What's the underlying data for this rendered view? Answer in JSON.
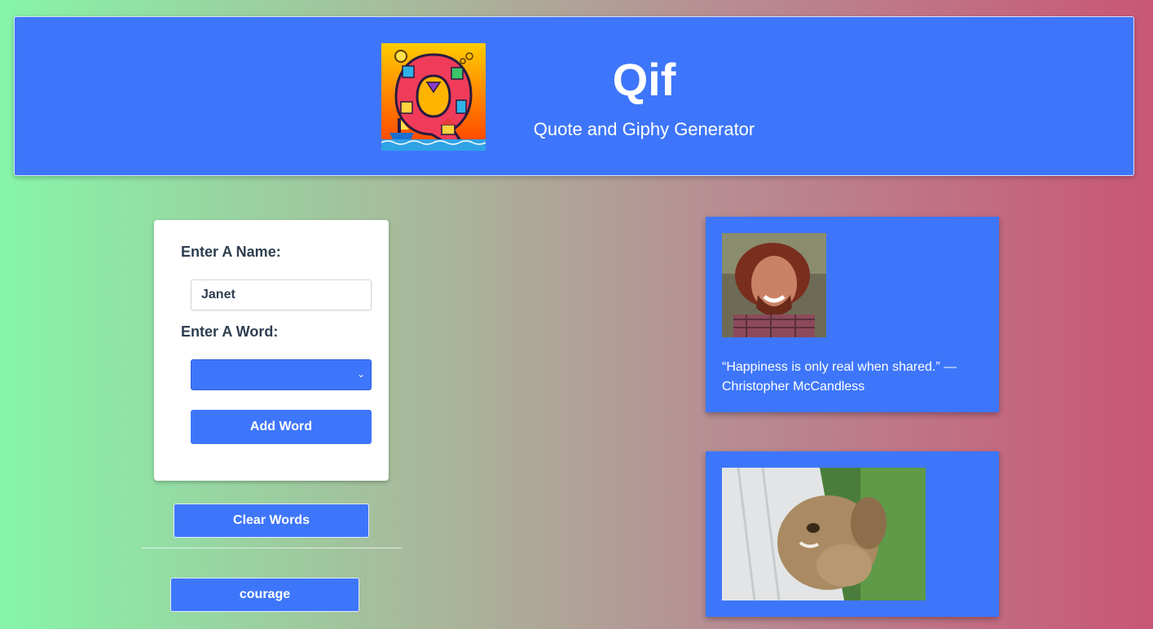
{
  "header": {
    "title": "Qif",
    "subtitle": "Quote and Giphy Generator",
    "logo_icon": "q-mosaic-logo"
  },
  "form": {
    "name_label": "Enter A Name:",
    "name_value": "Janet",
    "word_label": "Enter A Word:",
    "word_selected": "",
    "add_word_label": "Add Word"
  },
  "actions": {
    "clear_words_label": "Clear Words"
  },
  "words": [
    "courage"
  ],
  "results": [
    {
      "gif_icon": "smiling-bearded-man-gif",
      "quote": "“Happiness is only real when shared.” — Christopher McCandless"
    },
    {
      "gif_icon": "bunny-gif",
      "quote": ""
    }
  ],
  "colors": {
    "primary": "#3e76fb",
    "gradient_start": "#86f5a9",
    "gradient_end": "#c95677",
    "label_text": "#2e3e50"
  }
}
